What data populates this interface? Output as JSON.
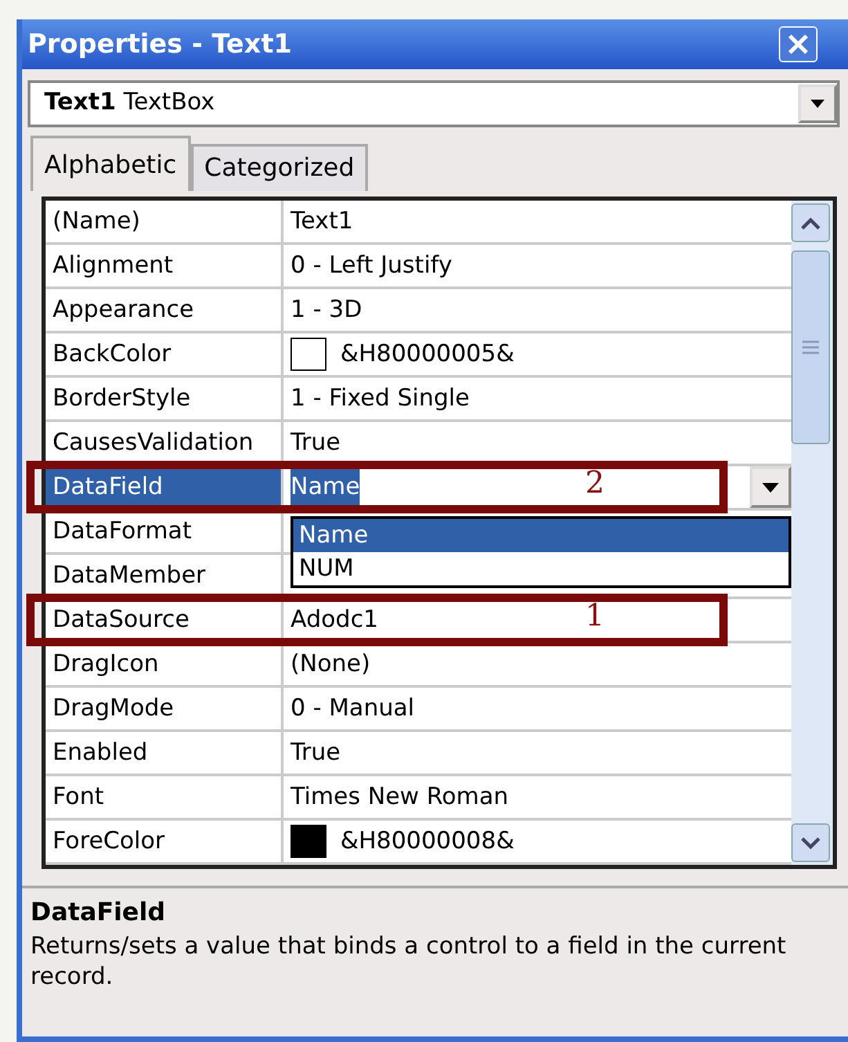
{
  "window": {
    "title": "Properties - Text1"
  },
  "object_selector": {
    "name": "Text1",
    "type": "TextBox"
  },
  "tabs": [
    {
      "label": "Alphabetic",
      "selected": true
    },
    {
      "label": "Categorized",
      "selected": false
    }
  ],
  "properties": [
    {
      "name": "(Name)",
      "value": "Text1",
      "selected": false
    },
    {
      "name": "Alignment",
      "value": "0 - Left Justify",
      "selected": false
    },
    {
      "name": "Appearance",
      "value": "1 - 3D",
      "selected": false
    },
    {
      "name": "BackColor",
      "value": "&H80000005&",
      "color": "#ffffff",
      "selected": false
    },
    {
      "name": "BorderStyle",
      "value": "1 - Fixed Single",
      "selected": false
    },
    {
      "name": "CausesValidation",
      "value": "True",
      "selected": false
    },
    {
      "name": "DataField",
      "value": "Name",
      "selected": true,
      "annotation": "2",
      "dropdown": [
        {
          "label": "Name",
          "selected": true
        },
        {
          "label": "NUM",
          "selected": false
        }
      ]
    },
    {
      "name": "DataFormat",
      "selected": false
    },
    {
      "name": "DataMember",
      "selected": false
    },
    {
      "name": "DataSource",
      "value": "Adodc1",
      "selected": false,
      "annotation": "1"
    },
    {
      "name": "DragIcon",
      "value": "(None)",
      "selected": false
    },
    {
      "name": "DragMode",
      "value": "0 - Manual",
      "selected": false
    },
    {
      "name": "Enabled",
      "value": "True",
      "selected": false
    },
    {
      "name": "Font",
      "value": "Times New Roman",
      "selected": false
    },
    {
      "name": "ForeColor",
      "value": "&H80000008&",
      "color": "#000000",
      "selected": false
    }
  ],
  "description": {
    "title": "DataField",
    "text": "Returns/sets a value that binds a control to a field in the current record."
  }
}
